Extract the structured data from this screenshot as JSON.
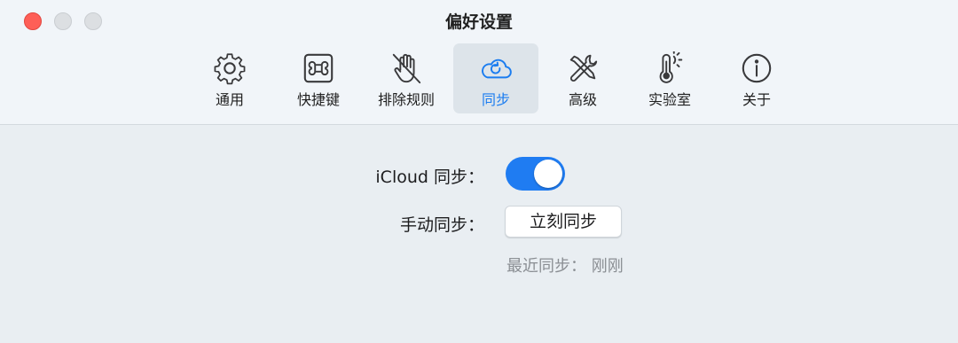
{
  "window": {
    "title": "偏好设置"
  },
  "tabs": [
    {
      "label": "通用",
      "icon": "gear-icon"
    },
    {
      "label": "快捷键",
      "icon": "command-key-icon"
    },
    {
      "label": "排除规则",
      "icon": "hand-slash-icon"
    },
    {
      "label": "同步",
      "icon": "cloud-sync-icon",
      "active": true
    },
    {
      "label": "高级",
      "icon": "tools-icon"
    },
    {
      "label": "实验室",
      "icon": "thermometer-icon"
    },
    {
      "label": "关于",
      "icon": "info-icon"
    }
  ],
  "sync": {
    "icloud_label": "iCloud 同步：",
    "icloud_enabled": true,
    "manual_label": "手动同步：",
    "sync_now_button": "立刻同步",
    "last_sync_label": "最近同步：",
    "last_sync_value": "刚刚"
  },
  "colors": {
    "accent": "#1a7cf0",
    "close": "#fe5f57",
    "background": "#e9eef2"
  }
}
